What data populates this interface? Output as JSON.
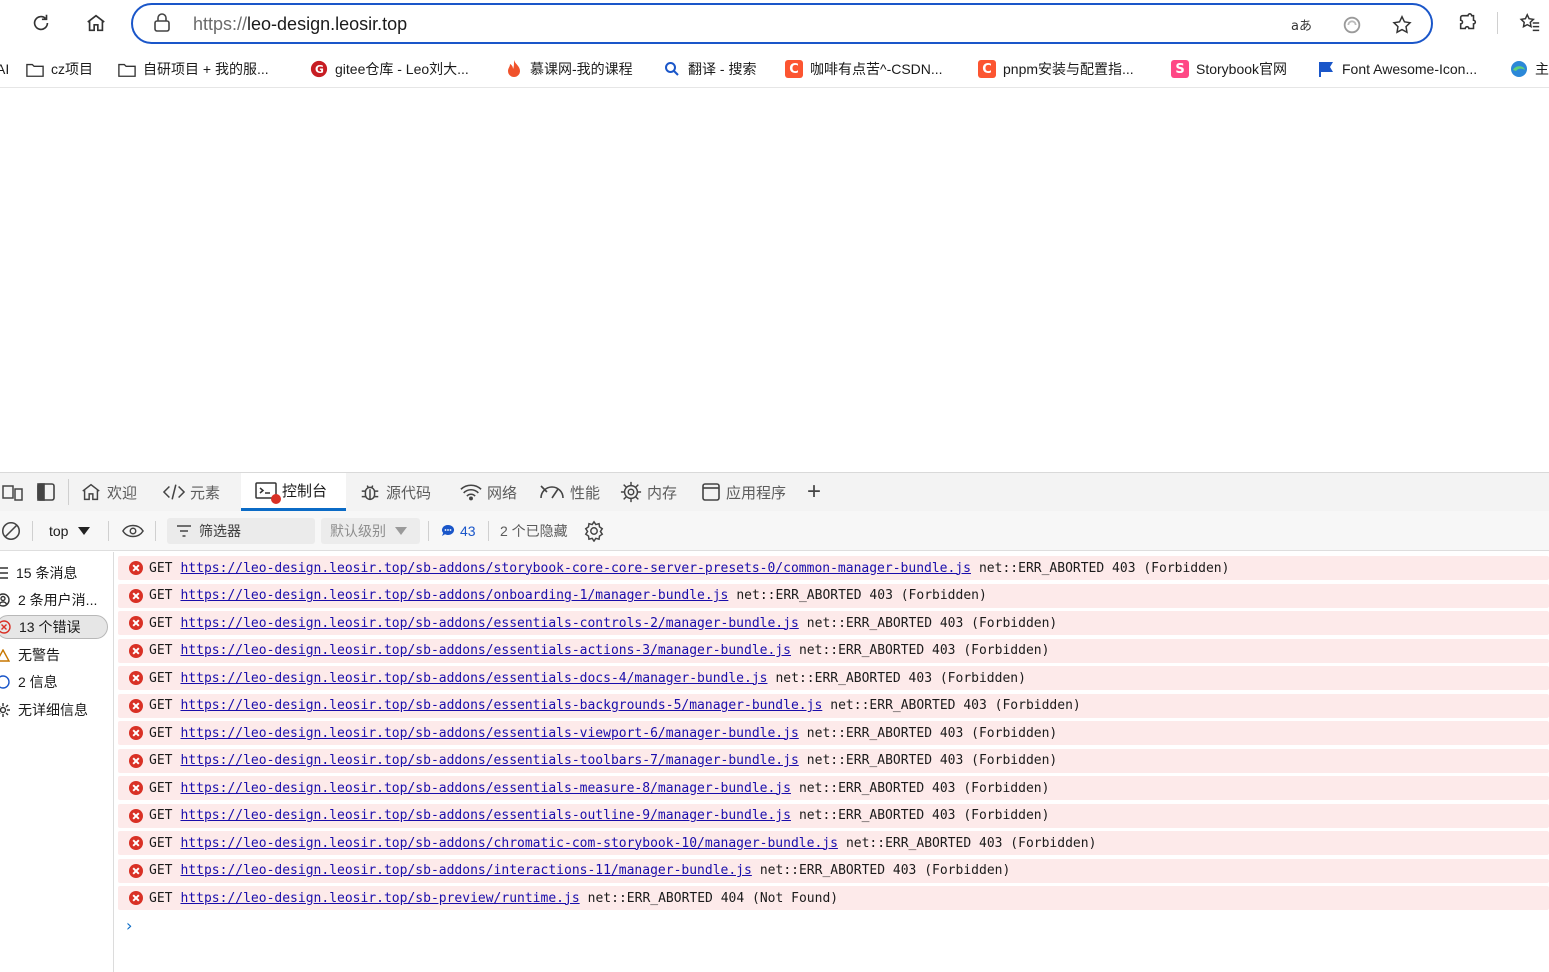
{
  "browser": {
    "url_scheme": "https://",
    "url_host": "leo-design.leosir.top",
    "read_aloud_icon": "read-aloud-icon",
    "refresh_icon": "refresh-icon",
    "home_icon": "home-icon"
  },
  "bookmarks": [
    {
      "label": "AI",
      "icon": "partial"
    },
    {
      "label": "cz项目",
      "icon": "folder"
    },
    {
      "label": "自研项目 + 我的服...",
      "icon": "folder"
    },
    {
      "label": "gitee仓库 - Leo刘大...",
      "icon": "gitee"
    },
    {
      "label": "慕课网-我的课程",
      "icon": "flame"
    },
    {
      "label": "翻译 - 搜索",
      "icon": "search"
    },
    {
      "label": "咖啡有点苦^-CSDN...",
      "icon": "csdn",
      "letter": "C"
    },
    {
      "label": "pnpm安装与配置指...",
      "icon": "csdn",
      "letter": "C"
    },
    {
      "label": "Storybook官网",
      "icon": "storybook",
      "letter": "S"
    },
    {
      "label": "Font Awesome-Icon...",
      "icon": "flag"
    },
    {
      "label": "主",
      "icon": "edge"
    }
  ],
  "devtools": {
    "tabs": [
      {
        "label": "欢迎",
        "icon": "home-icon"
      },
      {
        "label": "元素",
        "icon": "code-icon"
      },
      {
        "label": "控制台",
        "icon": "console-icon",
        "active": true
      },
      {
        "label": "源代码",
        "icon": "bug-icon"
      },
      {
        "label": "网络",
        "icon": "wifi-icon"
      },
      {
        "label": "性能",
        "icon": "gauge-icon"
      },
      {
        "label": "内存",
        "icon": "chip-icon"
      },
      {
        "label": "应用程序",
        "icon": "app-icon"
      }
    ],
    "add_tab_label": "+",
    "context": "top",
    "filter_placeholder": "筛选器",
    "level": "默认级别",
    "message_count": "43",
    "hidden_count": "2 个已隐藏",
    "sidebar": [
      {
        "label": "15 条消息",
        "icon": "list-icon"
      },
      {
        "label": "2 条用户消...",
        "icon": "user-icon"
      },
      {
        "label": "13 个错误",
        "icon": "error-icon",
        "selected": true
      },
      {
        "label": "无警告",
        "icon": "warning-icon"
      },
      {
        "label": "2 信息",
        "icon": "info-icon"
      },
      {
        "label": "无详细信息",
        "icon": "verbose-icon"
      }
    ],
    "log": [
      {
        "method": "GET",
        "url": "https://leo-design.leosir.top/sb-addons/storybook-core-core-server-presets-0/common-manager-bundle.js",
        "error": "net::ERR_ABORTED 403 (Forbidden)"
      },
      {
        "method": "GET",
        "url": "https://leo-design.leosir.top/sb-addons/onboarding-1/manager-bundle.js",
        "error": "net::ERR_ABORTED 403 (Forbidden)"
      },
      {
        "method": "GET",
        "url": "https://leo-design.leosir.top/sb-addons/essentials-controls-2/manager-bundle.js",
        "error": "net::ERR_ABORTED 403 (Forbidden)"
      },
      {
        "method": "GET",
        "url": "https://leo-design.leosir.top/sb-addons/essentials-actions-3/manager-bundle.js",
        "error": "net::ERR_ABORTED 403 (Forbidden)"
      },
      {
        "method": "GET",
        "url": "https://leo-design.leosir.top/sb-addons/essentials-docs-4/manager-bundle.js",
        "error": "net::ERR_ABORTED 403 (Forbidden)"
      },
      {
        "method": "GET",
        "url": "https://leo-design.leosir.top/sb-addons/essentials-backgrounds-5/manager-bundle.js",
        "error": "net::ERR_ABORTED 403 (Forbidden)"
      },
      {
        "method": "GET",
        "url": "https://leo-design.leosir.top/sb-addons/essentials-viewport-6/manager-bundle.js",
        "error": "net::ERR_ABORTED 403 (Forbidden)"
      },
      {
        "method": "GET",
        "url": "https://leo-design.leosir.top/sb-addons/essentials-toolbars-7/manager-bundle.js",
        "error": "net::ERR_ABORTED 403 (Forbidden)"
      },
      {
        "method": "GET",
        "url": "https://leo-design.leosir.top/sb-addons/essentials-measure-8/manager-bundle.js",
        "error": "net::ERR_ABORTED 403 (Forbidden)"
      },
      {
        "method": "GET",
        "url": "https://leo-design.leosir.top/sb-addons/essentials-outline-9/manager-bundle.js",
        "error": "net::ERR_ABORTED 403 (Forbidden)"
      },
      {
        "method": "GET",
        "url": "https://leo-design.leosir.top/sb-addons/chromatic-com-storybook-10/manager-bundle.js",
        "error": "net::ERR_ABORTED 403 (Forbidden)"
      },
      {
        "method": "GET",
        "url": "https://leo-design.leosir.top/sb-addons/interactions-11/manager-bundle.js",
        "error": "net::ERR_ABORTED 403 (Forbidden)"
      },
      {
        "method": "GET",
        "url": "https://leo-design.leosir.top/sb-preview/runtime.js",
        "error": "net::ERR_ABORTED 404 (Not Found)"
      }
    ],
    "prompt": "›"
  },
  "colors": {
    "accent": "#1a56c9",
    "error": "#d93025",
    "error_bg": "#fdeaea",
    "link": "#1a0dab"
  }
}
